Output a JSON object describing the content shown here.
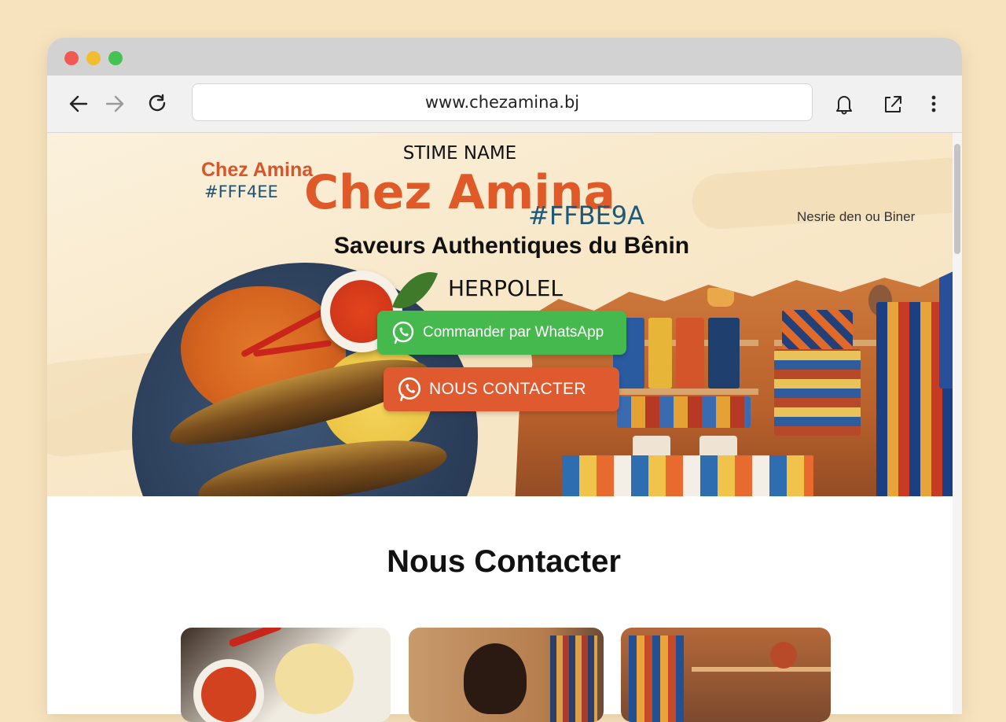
{
  "browser": {
    "url": "www.chezamina.bj",
    "toolbar_icons": [
      "back-arrow-icon",
      "forward-arrow-icon",
      "reload-icon",
      "bell-icon",
      "share-icon",
      "more-icon"
    ]
  },
  "hero": {
    "top_label": "STIME NAME",
    "brand": "Chez Amina",
    "brand_color_code": "#FFBE9A",
    "logo_text": "Chez Amina",
    "logo_color_code": "#FFF4EE",
    "side_text": "Nesrie den ou Biner",
    "tagline": "Saveurs Authentiques du Bênin",
    "sub_label": "HERPOLEL",
    "whatsapp_button": "Commander par WhatsApp",
    "contact_button": "NOUS CONTACTER"
  },
  "contact_section": {
    "title": "Nous Contacter"
  },
  "colors": {
    "accent_orange": "#df5a2e",
    "whatsapp_green": "#46b94e",
    "hex_blue": "#1f5978",
    "page_background": "#f7e4bf"
  }
}
